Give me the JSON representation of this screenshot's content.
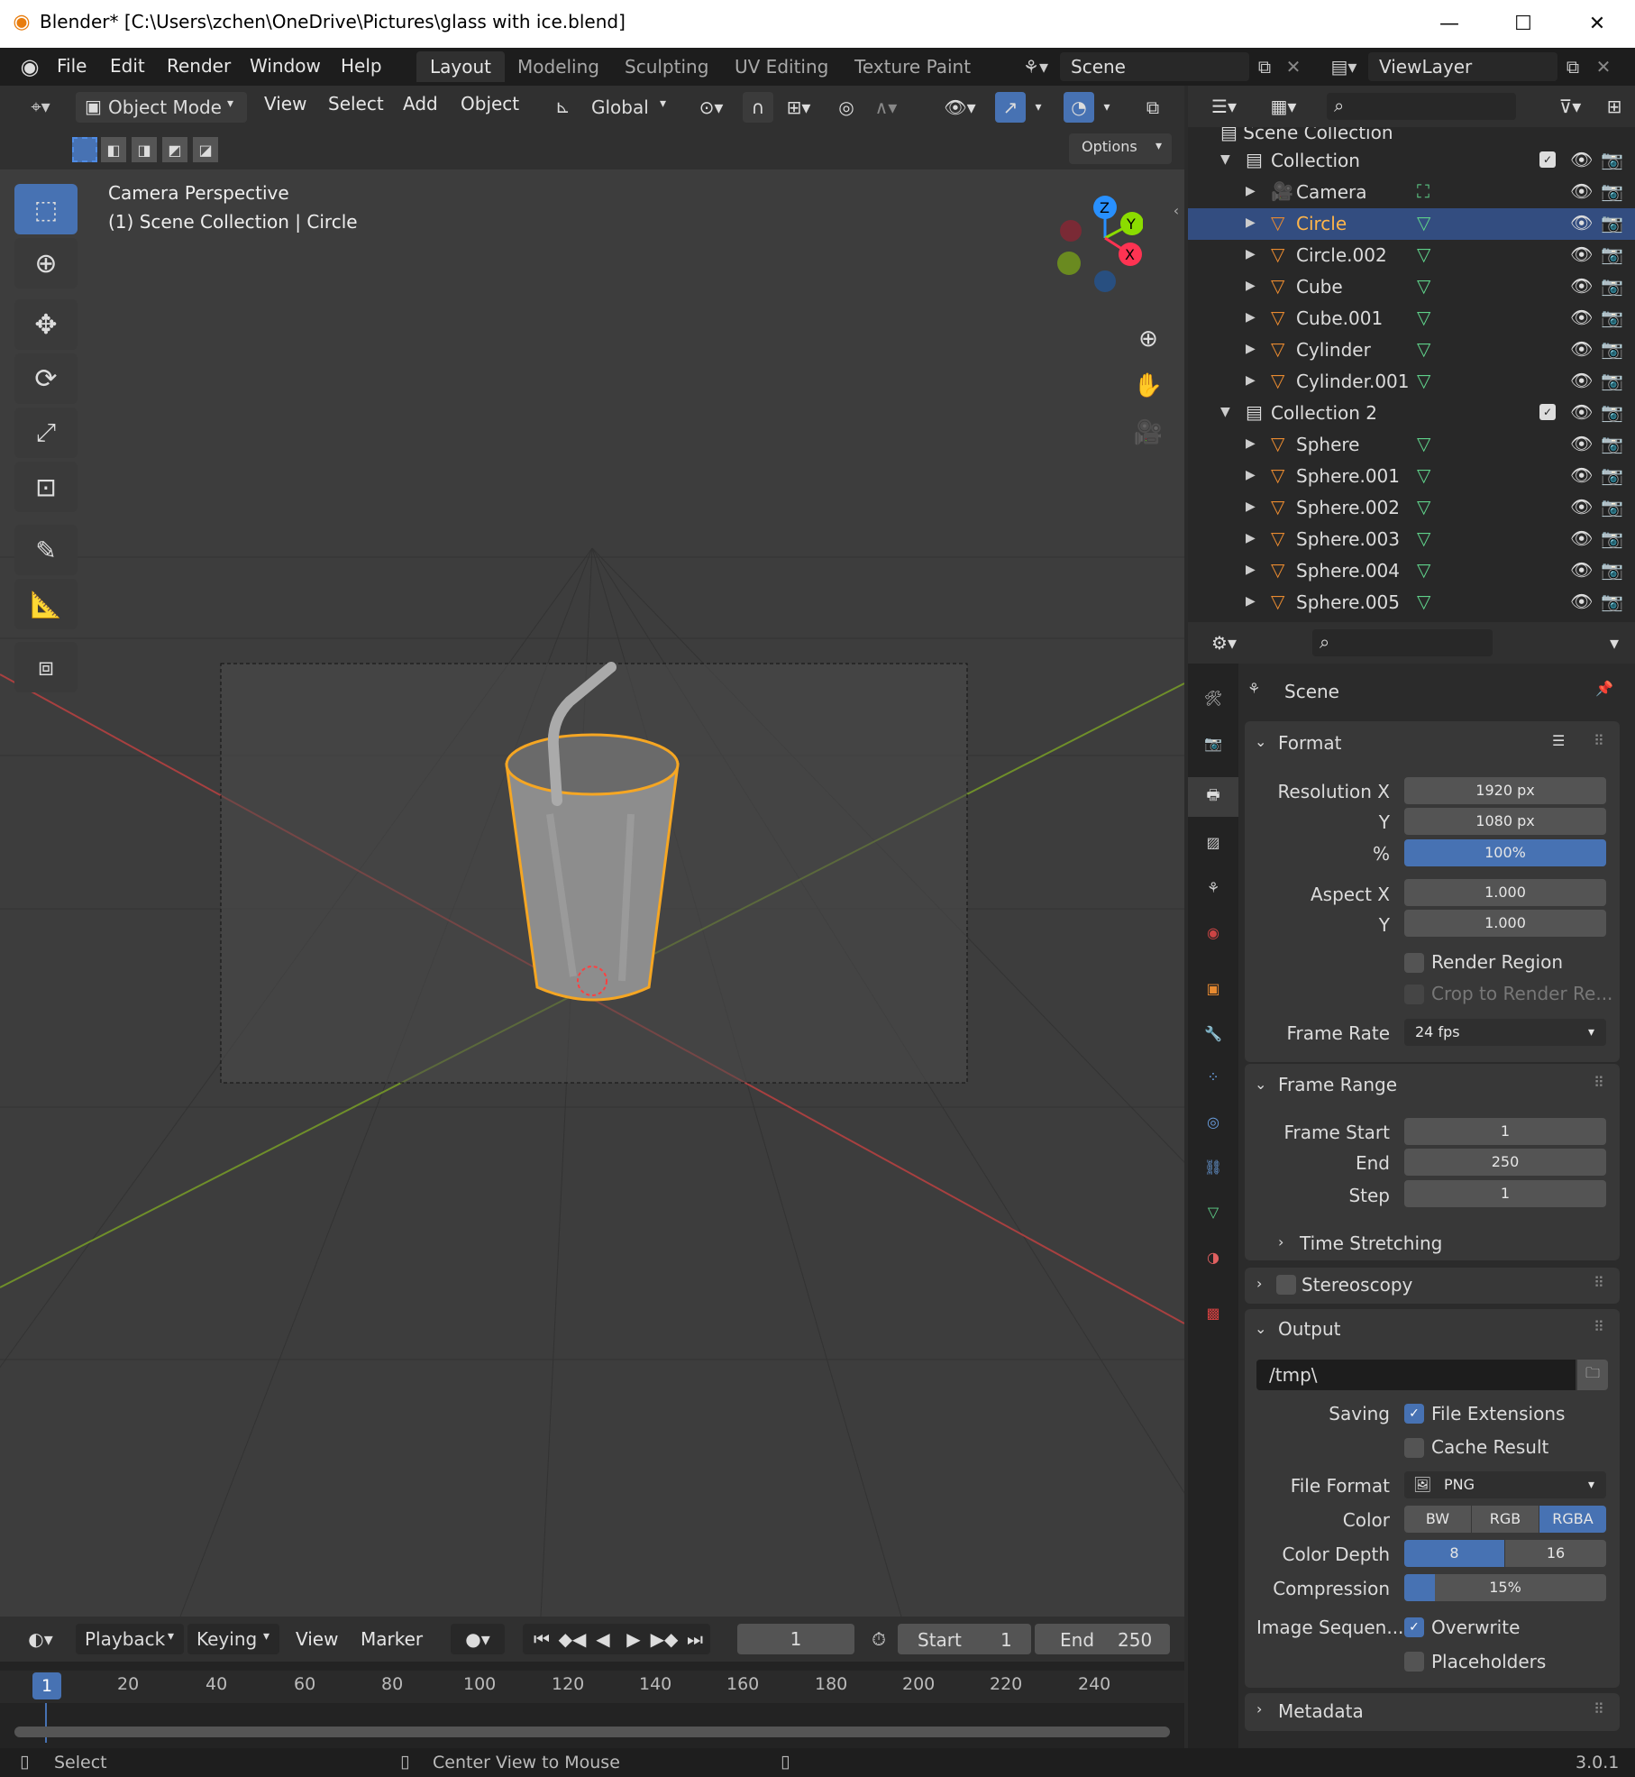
{
  "window": {
    "title": "Blender* [C:\\Users\\zchen\\OneDrive\\Pictures\\glass with ice.blend]",
    "minimize": "—",
    "maximize": "☐",
    "close": "✕"
  },
  "menus": [
    "File",
    "Edit",
    "Render",
    "Window",
    "Help"
  ],
  "workspaces": [
    "Layout",
    "Modeling",
    "Sculpting",
    "UV Editing",
    "Texture Paint"
  ],
  "scene": {
    "name": "Scene",
    "view_layer": "ViewLayer"
  },
  "viewport_header": {
    "mode": "Object Mode",
    "menus": [
      "View",
      "Select",
      "Add",
      "Object"
    ],
    "orientation": "Global",
    "options": "Options"
  },
  "viewport": {
    "camera_label": "Camera Perspective",
    "collection_label": "(1) Scene Collection | Circle",
    "axes": {
      "z": "Z",
      "y": "Y",
      "x": "X"
    }
  },
  "outliner": {
    "root": "Scene Collection",
    "rows": [
      {
        "label": "Collection",
        "kind": "collection"
      },
      {
        "label": "Camera",
        "kind": "camera"
      },
      {
        "label": "Circle",
        "kind": "mesh",
        "selected": true
      },
      {
        "label": "Circle.002",
        "kind": "mesh"
      },
      {
        "label": "Cube",
        "kind": "mesh"
      },
      {
        "label": "Cube.001",
        "kind": "mesh"
      },
      {
        "label": "Cylinder",
        "kind": "mesh"
      },
      {
        "label": "Cylinder.001",
        "kind": "mesh"
      },
      {
        "label": "Collection 2",
        "kind": "collection"
      },
      {
        "label": "Sphere",
        "kind": "mesh"
      },
      {
        "label": "Sphere.001",
        "kind": "mesh"
      },
      {
        "label": "Sphere.002",
        "kind": "mesh"
      },
      {
        "label": "Sphere.003",
        "kind": "mesh"
      },
      {
        "label": "Sphere.004",
        "kind": "mesh"
      },
      {
        "label": "Sphere.005",
        "kind": "mesh"
      }
    ]
  },
  "properties": {
    "context": "Scene",
    "format": {
      "title": "Format",
      "res_x_label": "Resolution X",
      "res_x": "1920 px",
      "res_y_label": "Y",
      "res_y": "1080 px",
      "pct_label": "%",
      "pct": "100%",
      "aspect_x_label": "Aspect X",
      "aspect_x": "1.000",
      "aspect_y_label": "Y",
      "aspect_y": "1.000",
      "render_region": "Render Region",
      "crop": "Crop to Render Re...",
      "frame_rate_label": "Frame Rate",
      "frame_rate": "24 fps"
    },
    "frame_range": {
      "title": "Frame Range",
      "start_label": "Frame Start",
      "start": "1",
      "end_label": "End",
      "end": "250",
      "step_label": "Step",
      "step": "1",
      "time_stretching": "Time Stretching"
    },
    "stereoscopy": "Stereoscopy",
    "output": {
      "title": "Output",
      "path": "/tmp\\",
      "saving_label": "Saving",
      "file_ext": "File Extensions",
      "cache": "Cache Result",
      "file_format_label": "File Format",
      "file_format": "PNG",
      "color_label": "Color",
      "color_opts": [
        "BW",
        "RGB",
        "RGBA"
      ],
      "depth_label": "Color Depth",
      "depth_opts": [
        "8",
        "16"
      ],
      "compression_label": "Compression",
      "compression": "15%",
      "compression_value": 0.15,
      "imgseq_label": "Image Sequen...",
      "overwrite": "Overwrite",
      "placeholders": "Placeholders"
    },
    "metadata": "Metadata"
  },
  "timeline": {
    "menus": [
      "Playback",
      "Keying",
      "View",
      "Marker"
    ],
    "current": "1",
    "start_label": "Start",
    "start": "1",
    "end_label": "End",
    "end": "250",
    "ticks": [
      "1",
      "20",
      "40",
      "60",
      "80",
      "100",
      "120",
      "140",
      "160",
      "180",
      "200",
      "220",
      "240"
    ]
  },
  "status": {
    "select": "Select",
    "center": "Center View to Mouse",
    "version": "3.0.1"
  },
  "colors": {
    "accent": "#4772b3",
    "selection_outline": "#f5a623",
    "x_axis": "#ff3352",
    "y_axis": "#8bdc00",
    "z_axis": "#2890ff"
  }
}
